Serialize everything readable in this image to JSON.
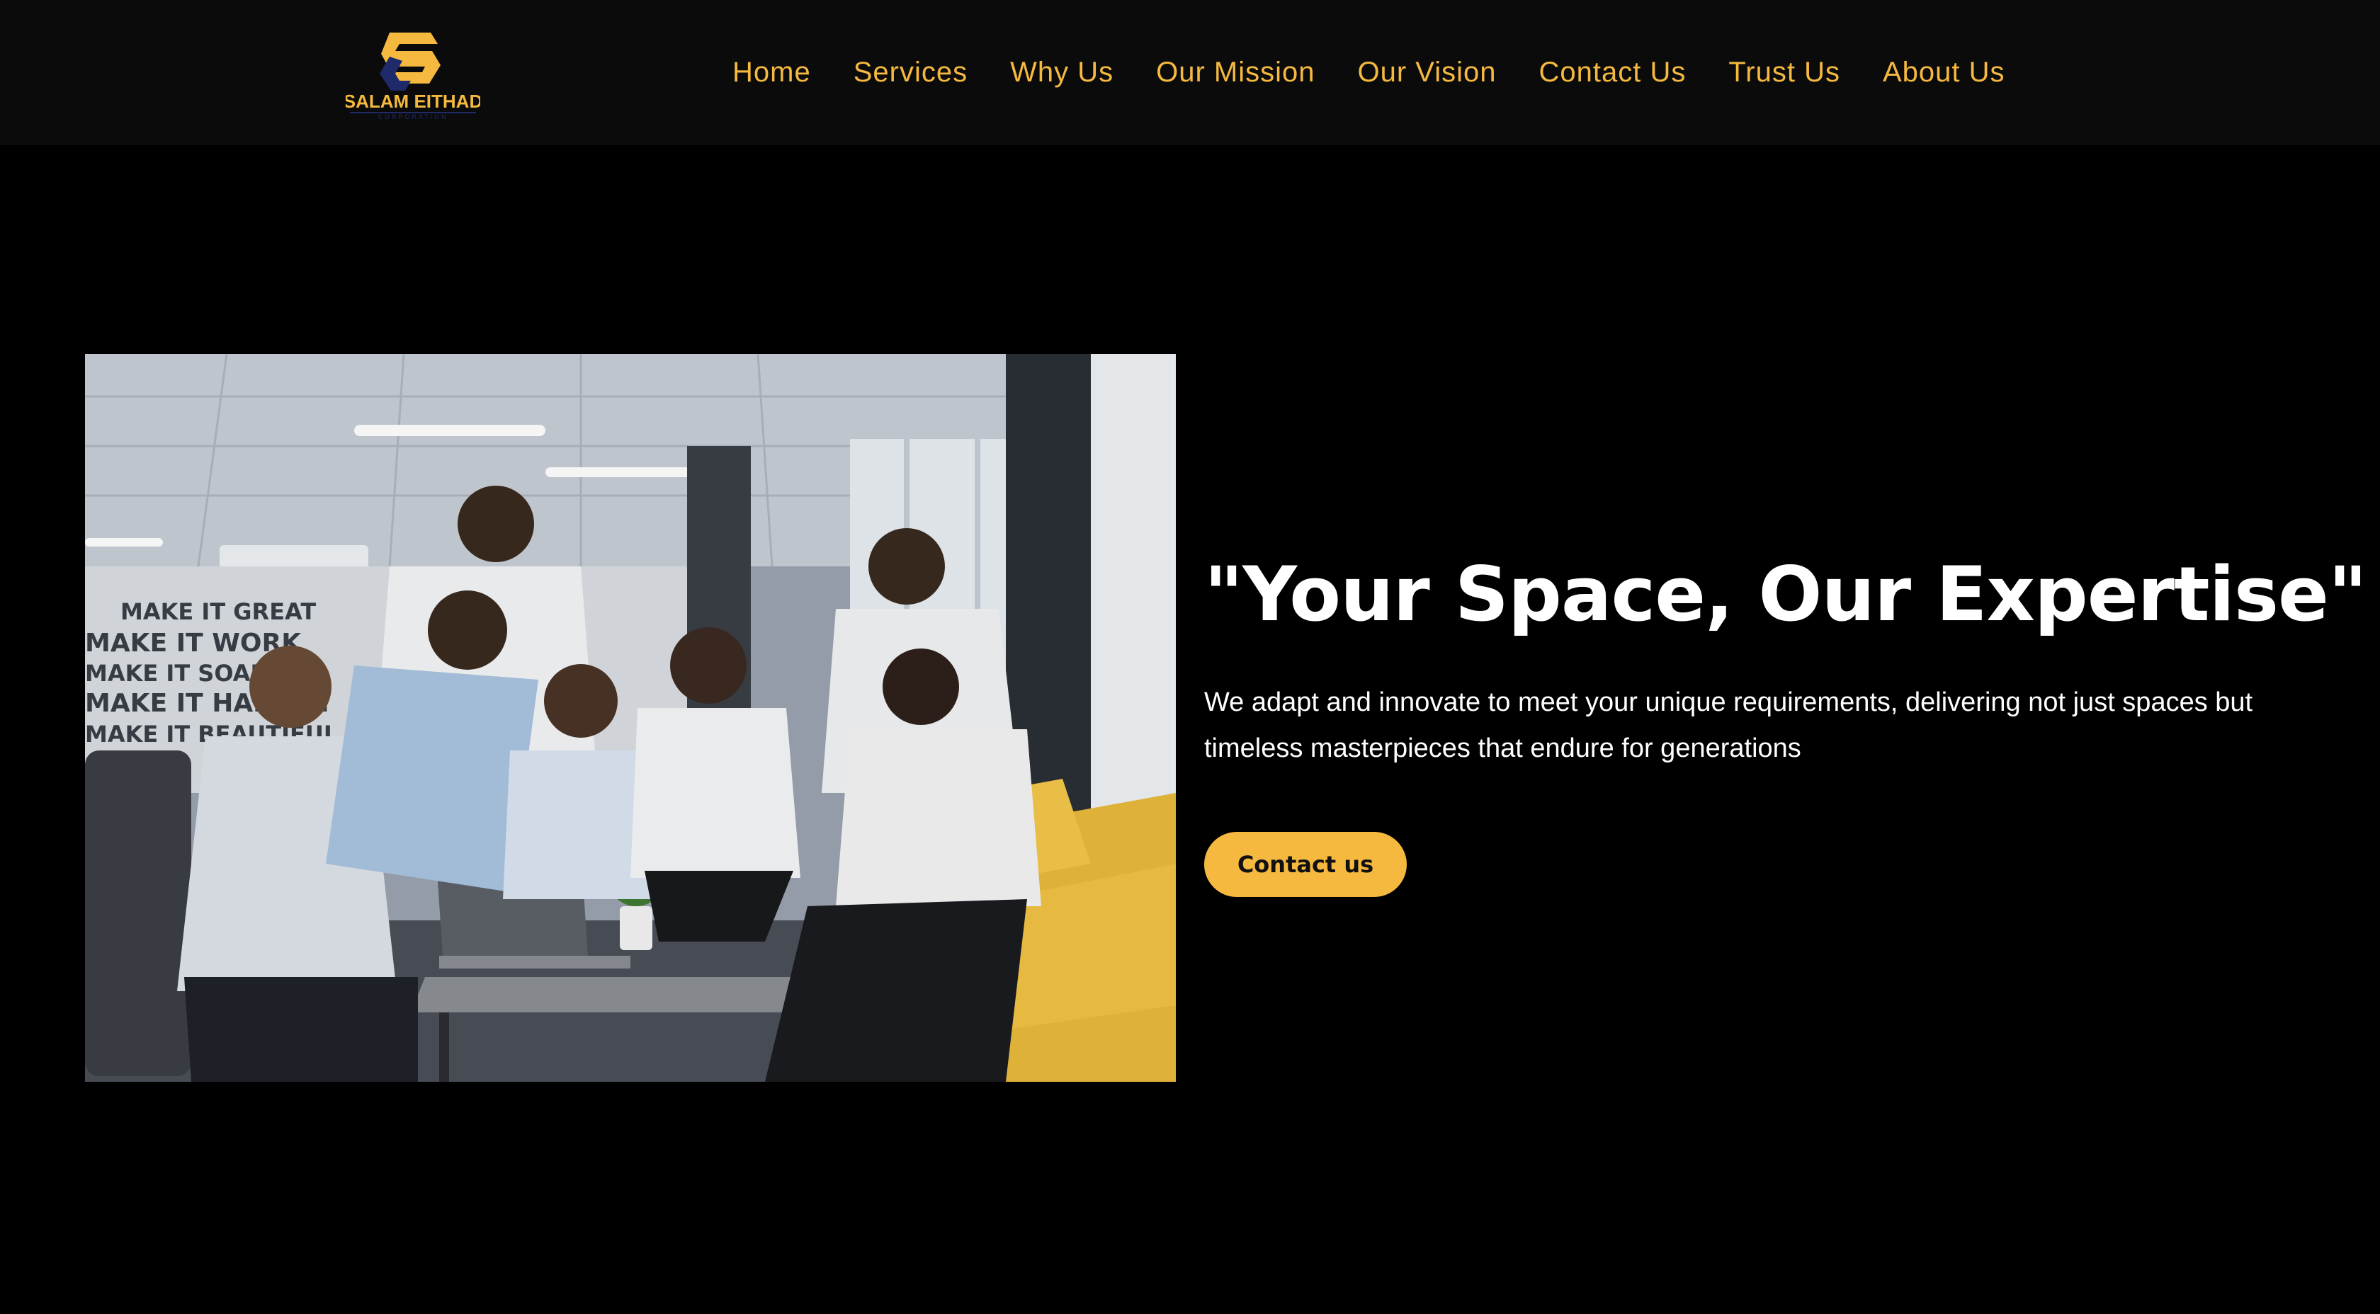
{
  "header": {
    "logo": {
      "name": "SALAM EITHAD",
      "tagline": "CORPORATION",
      "icon": "salam-eithad-logo-icon"
    },
    "nav": [
      {
        "label": "Home"
      },
      {
        "label": "Services"
      },
      {
        "label": "Why Us"
      },
      {
        "label": "Our Mission"
      },
      {
        "label": "Our Vision"
      },
      {
        "label": "Contact Us"
      },
      {
        "label": "Trust Us"
      },
      {
        "label": "About Us"
      }
    ]
  },
  "hero": {
    "image": {
      "wall_text": [
        "MAKE IT GREAT",
        "MAKE IT WORK",
        "MAKE IT SOAR",
        "MAKE IT HAPPEN",
        "MAKE IT BEAUTIFUL"
      ]
    },
    "headline": "\"Your Space, Our Expertise\"",
    "subtext": "We adapt and innovate to meet your unique requirements, delivering not just spaces but timeless masterpieces that endure for generations",
    "cta_label": "Contact us"
  },
  "colors": {
    "accent": "#f5b940",
    "background": "#000000",
    "header_background": "#0b0b0b",
    "logo_blue": "#1f2a6b"
  }
}
